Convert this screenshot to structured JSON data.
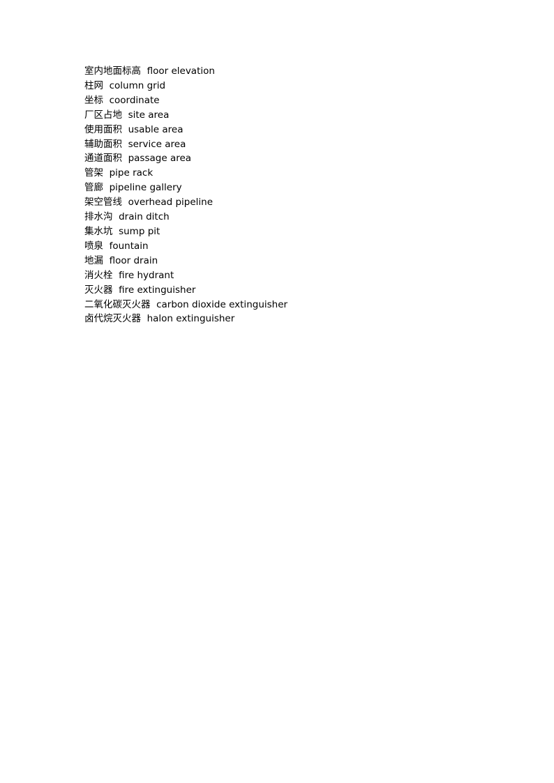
{
  "document": {
    "page_background": "#ffffff",
    "text_color": "#000000",
    "page_number_visible": false,
    "entries": [
      {
        "zh": "室内地面标高",
        "en": "floor elevation"
      },
      {
        "zh": "柱网",
        "en": "column grid"
      },
      {
        "zh": "坐标",
        "en": "coordinate"
      },
      {
        "zh": "厂区占地",
        "en": "site area"
      },
      {
        "zh": "使用面积",
        "en": "usable area"
      },
      {
        "zh": "辅助面积",
        "en": "service area"
      },
      {
        "zh": "通道面积",
        "en": "passage area"
      },
      {
        "zh": "管架",
        "en": "pipe rack"
      },
      {
        "zh": "管廊",
        "en": "pipeline gallery"
      },
      {
        "zh": "架空管线",
        "en": "overhead pipeline"
      },
      {
        "zh": "排水沟",
        "en": "drain ditch"
      },
      {
        "zh": "集水坑",
        "en": "sump pit"
      },
      {
        "zh": "喷泉",
        "en": "fountain"
      },
      {
        "zh": "地漏",
        "en": "floor drain"
      },
      {
        "zh": "消火栓",
        "en": "fire hydrant"
      },
      {
        "zh": "灭火器",
        "en": "fire extinguisher"
      },
      {
        "zh": "二氧化碳灭火器",
        "en": "carbon dioxide extinguisher"
      },
      {
        "zh": "卤代烷灭火器",
        "en": "halon extinguisher"
      }
    ],
    "separator": "  "
  }
}
